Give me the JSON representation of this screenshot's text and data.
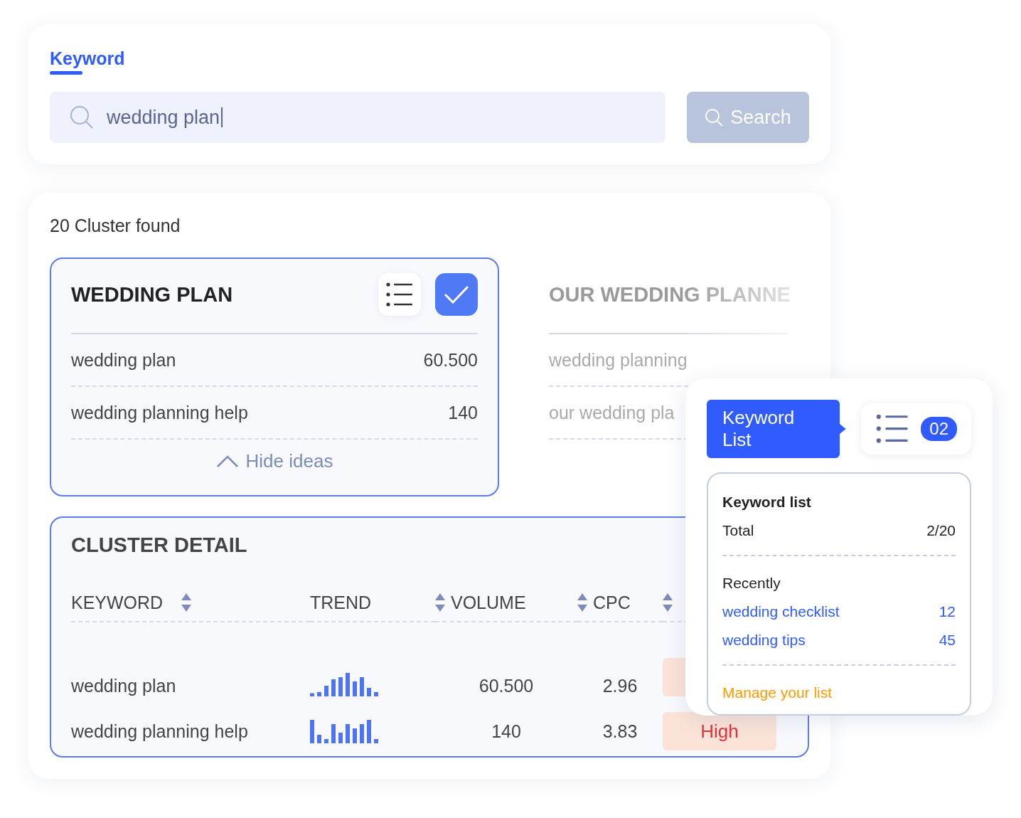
{
  "search_card": {
    "tabs": [
      {
        "label": "Keyword",
        "selected": true
      }
    ],
    "search": {
      "value": "wedding plan"
    },
    "search_button": {
      "label": "Search",
      "disabled": true
    }
  },
  "results": {
    "count_label": "20 Cluster found",
    "clusters": [
      {
        "title": "WEDDING PLAN",
        "selected": true,
        "checked": true,
        "rows": [
          {
            "keyword": "wedding plan",
            "volume": "60.500"
          },
          {
            "keyword": "wedding planning help",
            "volume": "140"
          }
        ],
        "toggle": "Hide ideas"
      },
      {
        "title": "OUR WEDDING PLANNE",
        "selected": false,
        "rows": [
          {
            "keyword": "wedding planning"
          },
          {
            "keyword": "our wedding pla"
          }
        ]
      }
    ],
    "detail": {
      "title": "CLUSTER DETAIL",
      "columns": [
        {
          "label": "KEYWORD",
          "sortable": true
        },
        {
          "label": "TREND",
          "sortable": false
        },
        {
          "label": "VOLUME",
          "sortable": true
        },
        {
          "label": "CPC",
          "sortable": true
        },
        {
          "sortable": true
        }
      ],
      "rows": [
        {
          "keyword": "wedding plan",
          "volume": "60.500",
          "cpc": "2.96"
        },
        {
          "keyword": "wedding planning help",
          "volume": "140",
          "cpc": "3.83",
          "competition": "High"
        }
      ]
    }
  },
  "popup": {
    "tag": "Keyword List",
    "count": "02",
    "title": "Keyword list",
    "total_label": "Total",
    "total_value": "2/20",
    "recent_label": "Recently",
    "recent": [
      {
        "keyword": "wedding checklist",
        "count": "12"
      },
      {
        "keyword": "wedding tips",
        "count": "45"
      }
    ],
    "manage_link": "Manage your list"
  }
}
